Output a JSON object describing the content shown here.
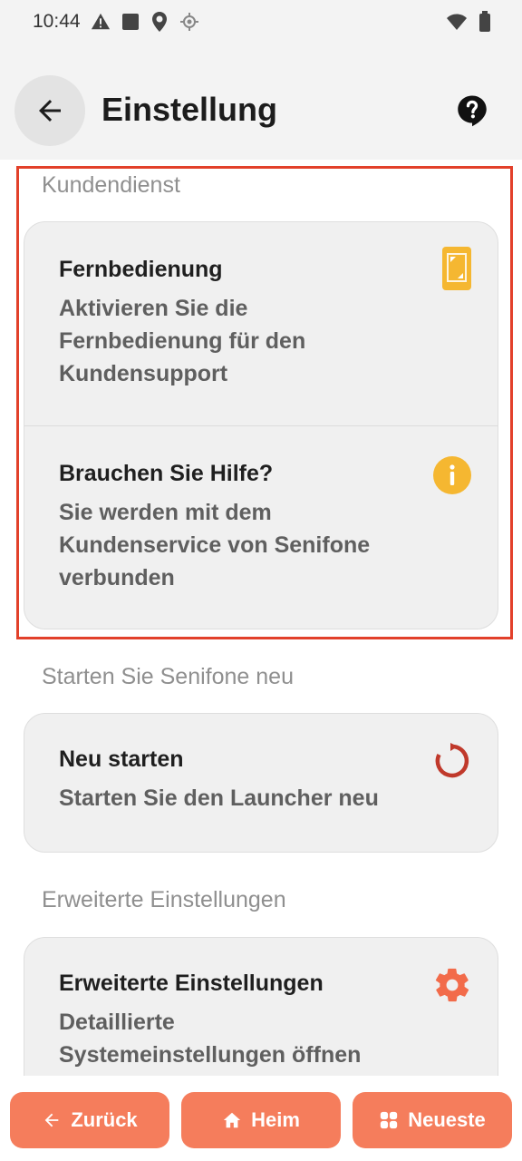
{
  "status": {
    "time": "10:44"
  },
  "appbar": {
    "title": "Einstellung"
  },
  "sections": {
    "support": {
      "label": "Kundendienst",
      "items": [
        {
          "title": "Fernbedienung",
          "desc_l1": "Aktivieren Sie die",
          "desc_l2": "Fernbedienung für den",
          "desc_l3": "Kundensupport",
          "icon": "remote-phone-icon"
        },
        {
          "title": "Brauchen Sie Hilfe?",
          "desc_l1": "Sie werden mit dem",
          "desc_l2": "Kundenservice von Senifone",
          "desc_l3": "verbunden",
          "icon": "info-icon"
        }
      ]
    },
    "restart": {
      "label": "Starten Sie Senifone neu",
      "items": [
        {
          "title": "Neu starten",
          "desc_l1": "Starten Sie den Launcher neu",
          "icon": "restart-icon"
        }
      ]
    },
    "advanced": {
      "label": "Erweiterte Einstellungen",
      "items": [
        {
          "title": "Erweiterte Einstellungen",
          "desc_l1": "Detaillierte",
          "desc_l2": "Systemeinstellungen öffnen",
          "icon": "gear-icon"
        }
      ]
    }
  },
  "bottom_nav": {
    "back": "Zurück",
    "home": "Heim",
    "recent": "Neueste"
  },
  "colors": {
    "accent": "#f57d5c",
    "highlight_border": "#e2402a",
    "icon_yellow": "#f5b731",
    "restart_red": "#c0392b",
    "gear_orange": "#f26b4a"
  }
}
